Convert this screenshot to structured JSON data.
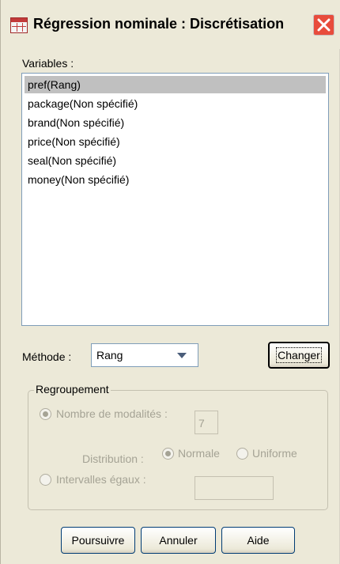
{
  "window": {
    "title": "Régression nominale : Discrétisation",
    "icon": "spss-data-icon"
  },
  "variables": {
    "label": "Variables :",
    "items": [
      {
        "label": "pref(Rang)",
        "selected": true
      },
      {
        "label": "package(Non spécifié)",
        "selected": false
      },
      {
        "label": "brand(Non spécifié)",
        "selected": false
      },
      {
        "label": "price(Non spécifié)",
        "selected": false
      },
      {
        "label": "seal(Non spécifié)",
        "selected": false
      },
      {
        "label": "money(Non spécifié)",
        "selected": false
      }
    ]
  },
  "method": {
    "label": "Méthode :",
    "selected": "Rang",
    "change_button": "Changer"
  },
  "grouping": {
    "legend": "Regroupement",
    "num_categories_label": "Nombre de modalités :",
    "num_categories_value": "7",
    "distribution_label": "Distribution :",
    "normal_label": "Normale",
    "uniform_label": "Uniforme",
    "equal_intervals_label": "Intervalles égaux :",
    "equal_intervals_value": ""
  },
  "buttons": {
    "continue": "Poursuivre",
    "cancel": "Annuler",
    "help": "Aide"
  },
  "colors": {
    "dialog_bg": "#ece9d8",
    "close_button": "#e84c3c",
    "selection": "#c0c0c0",
    "disabled_text": "#a5a395"
  }
}
